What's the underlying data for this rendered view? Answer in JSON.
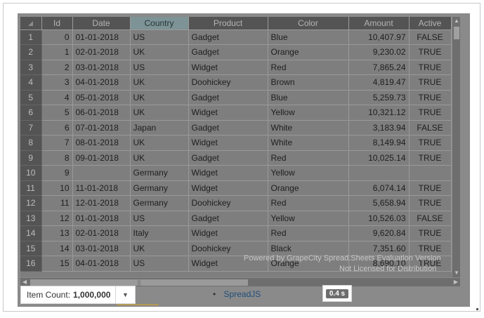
{
  "grid": {
    "columns": [
      "Id",
      "Date",
      "Country",
      "Product",
      "Color",
      "Amount",
      "Active"
    ],
    "selected_column": "Country",
    "rows": [
      {
        "rownum": "1",
        "id": "0",
        "date": "01-01-2018",
        "country": "US",
        "product": "Gadget",
        "color": "Blue",
        "amount": "10,407.97",
        "active": "FALSE"
      },
      {
        "rownum": "2",
        "id": "1",
        "date": "02-01-2018",
        "country": "UK",
        "product": "Gadget",
        "color": "Orange",
        "amount": "9,230.02",
        "active": "TRUE"
      },
      {
        "rownum": "3",
        "id": "2",
        "date": "03-01-2018",
        "country": "US",
        "product": "Widget",
        "color": "Red",
        "amount": "7,865.24",
        "active": "TRUE"
      },
      {
        "rownum": "4",
        "id": "3",
        "date": "04-01-2018",
        "country": "UK",
        "product": "Doohickey",
        "color": "Brown",
        "amount": "4,819.47",
        "active": "TRUE"
      },
      {
        "rownum": "5",
        "id": "4",
        "date": "05-01-2018",
        "country": "UK",
        "product": "Gadget",
        "color": "Blue",
        "amount": "5,259.73",
        "active": "TRUE"
      },
      {
        "rownum": "6",
        "id": "5",
        "date": "06-01-2018",
        "country": "UK",
        "product": "Widget",
        "color": "Yellow",
        "amount": "10,321.12",
        "active": "TRUE"
      },
      {
        "rownum": "7",
        "id": "6",
        "date": "07-01-2018",
        "country": "Japan",
        "product": "Gadget",
        "color": "White",
        "amount": "3,183.94",
        "active": "FALSE"
      },
      {
        "rownum": "8",
        "id": "7",
        "date": "08-01-2018",
        "country": "UK",
        "product": "Widget",
        "color": "White",
        "amount": "8,149.94",
        "active": "TRUE"
      },
      {
        "rownum": "9",
        "id": "8",
        "date": "09-01-2018",
        "country": "UK",
        "product": "Gadget",
        "color": "Red",
        "amount": "10,025.14",
        "active": "TRUE"
      },
      {
        "rownum": "10",
        "id": "9",
        "date": "",
        "country": "Germany",
        "product": "Widget",
        "color": "Yellow",
        "amount": "",
        "active": ""
      },
      {
        "rownum": "11",
        "id": "10",
        "date": "11-01-2018",
        "country": "Germany",
        "product": "Widget",
        "color": "Orange",
        "amount": "6,074.14",
        "active": "TRUE"
      },
      {
        "rownum": "12",
        "id": "11",
        "date": "12-01-2018",
        "country": "Germany",
        "product": "Doohickey",
        "color": "Red",
        "amount": "5,658.94",
        "active": "TRUE"
      },
      {
        "rownum": "13",
        "id": "12",
        "date": "01-01-2018",
        "country": "US",
        "product": "Gadget",
        "color": "Yellow",
        "amount": "10,526.03",
        "active": "FALSE"
      },
      {
        "rownum": "14",
        "id": "13",
        "date": "02-01-2018",
        "country": "Italy",
        "product": "Widget",
        "color": "Red",
        "amount": "9,620.84",
        "active": "TRUE"
      },
      {
        "rownum": "15",
        "id": "14",
        "date": "03-01-2018",
        "country": "UK",
        "product": "Doohickey",
        "color": "Black",
        "amount": "7,351.60",
        "active": "TRUE"
      },
      {
        "rownum": "16",
        "id": "15",
        "date": "04-01-2018",
        "country": "US",
        "product": "Widget",
        "color": "Orange",
        "amount": "8,690.10",
        "active": "TRUE"
      }
    ]
  },
  "watermark": {
    "line1": "Powered by GrapeCity Spread.Sheets Evaluation Version",
    "line2": "Not Licensed for Distribution"
  },
  "footer": {
    "item_count_label": "Item Count:",
    "item_count_value": "1,000,000",
    "link_label": "SpreadJS",
    "timer": "0.4 s"
  },
  "icons": {
    "dropdown": "chevron-down-icon",
    "scroll_up": "arrow-up-icon",
    "scroll_down": "arrow-down-icon",
    "scroll_left": "arrow-left-icon",
    "scroll_right": "arrow-right-icon"
  }
}
